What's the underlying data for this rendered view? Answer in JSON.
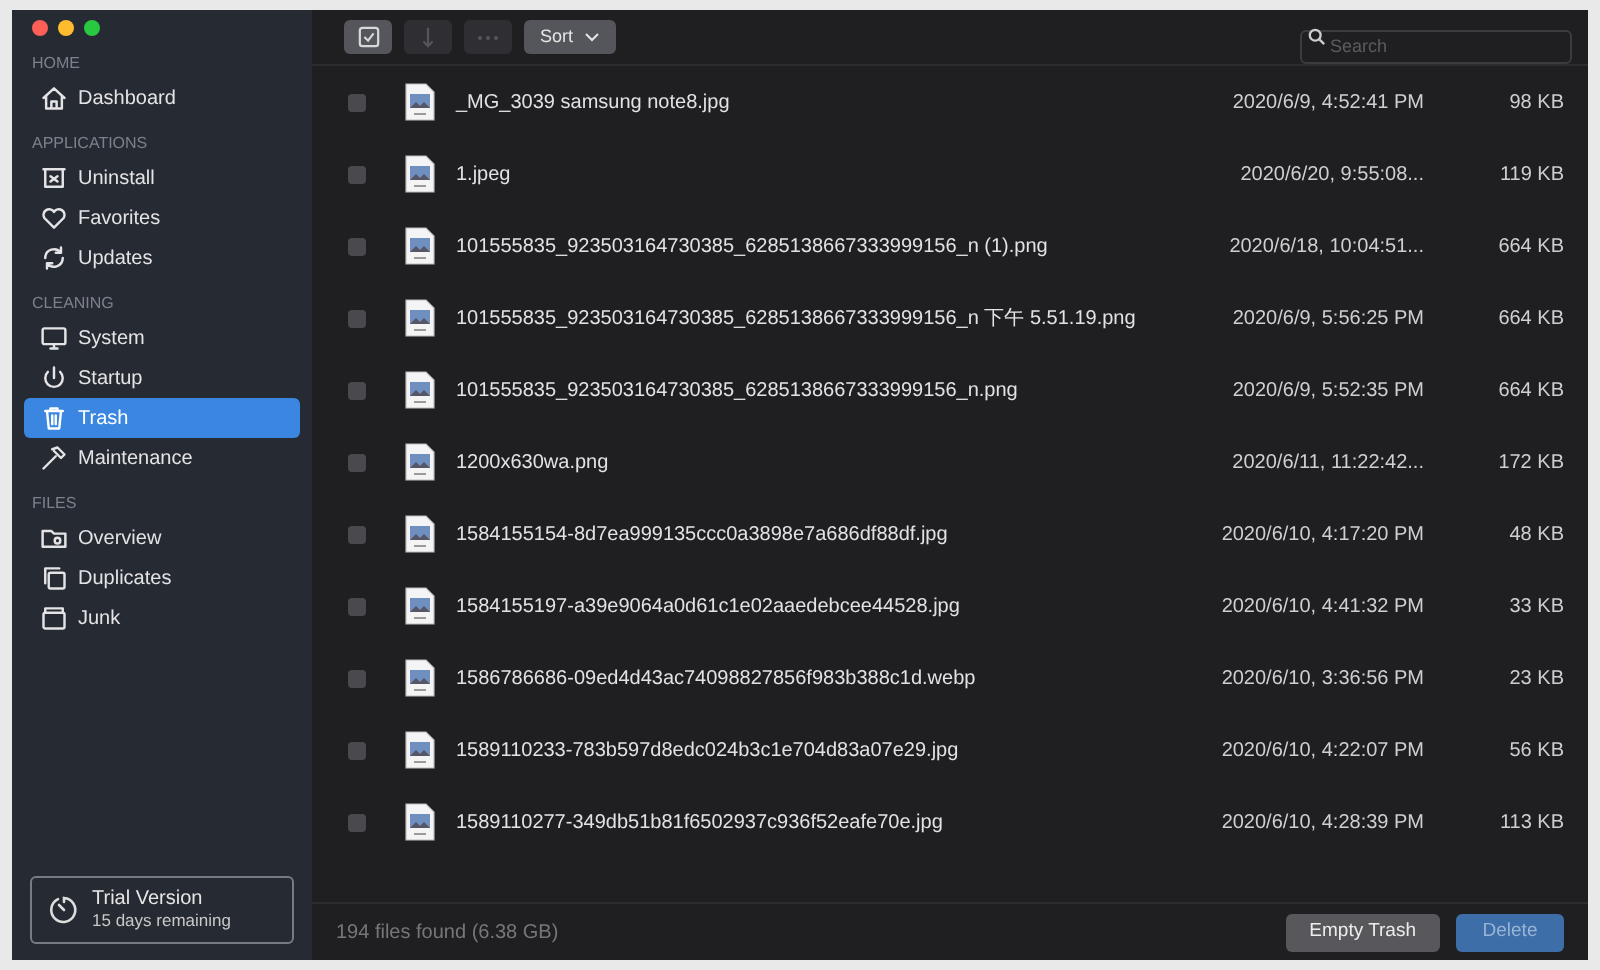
{
  "sidebar": {
    "sections": [
      {
        "heading": "HOME",
        "items": [
          {
            "label": "Dashboard",
            "kind": "home",
            "selected": false
          }
        ]
      },
      {
        "heading": "APPLICATIONS",
        "items": [
          {
            "label": "Uninstall",
            "kind": "uninstall",
            "selected": false
          },
          {
            "label": "Favorites",
            "kind": "heart",
            "selected": false
          },
          {
            "label": "Updates",
            "kind": "refresh",
            "selected": false
          }
        ]
      },
      {
        "heading": "CLEANING",
        "items": [
          {
            "label": "System",
            "kind": "monitor",
            "selected": false
          },
          {
            "label": "Startup",
            "kind": "power",
            "selected": false
          },
          {
            "label": "Trash",
            "kind": "trash",
            "selected": true
          },
          {
            "label": "Maintenance",
            "kind": "hammer",
            "selected": false
          }
        ]
      },
      {
        "heading": "FILES",
        "items": [
          {
            "label": "Overview",
            "kind": "folder",
            "selected": false
          },
          {
            "label": "Duplicates",
            "kind": "copy",
            "selected": false
          },
          {
            "label": "Junk",
            "kind": "box",
            "selected": false
          }
        ]
      }
    ],
    "trial": {
      "title": "Trial Version",
      "subtitle": "15 days remaining"
    }
  },
  "toolbar": {
    "buttons": [
      {
        "kind": "check",
        "disabled": false
      },
      {
        "kind": "arrow",
        "disabled": true
      },
      {
        "kind": "more",
        "disabled": true
      }
    ],
    "sort": {
      "label": "Sort"
    },
    "search": {
      "placeholder": "Search"
    }
  },
  "files": [
    {
      "name": "_MG_3039 samsung note8.jpg",
      "date": "2020/6/9, 4:52:41 PM",
      "size": "98 KB",
      "checked": false
    },
    {
      "name": "1.jpeg",
      "date": "2020/6/20, 9:55:08...",
      "size": "119 KB",
      "checked": false
    },
    {
      "name": "101555835_923503164730385_6285138667333999156_n (1).png",
      "date": "2020/6/18, 10:04:51...",
      "size": "664 KB",
      "checked": false
    },
    {
      "name": "101555835_923503164730385_6285138667333999156_n 下午 5.51.19.png",
      "date": "2020/6/9, 5:56:25 PM",
      "size": "664 KB",
      "checked": false
    },
    {
      "name": "101555835_923503164730385_6285138667333999156_n.png",
      "date": "2020/6/9, 5:52:35 PM",
      "size": "664 KB",
      "checked": false
    },
    {
      "name": "1200x630wa.png",
      "date": "2020/6/11, 11:22:42...",
      "size": "172 KB",
      "checked": false
    },
    {
      "name": "1584155154-8d7ea999135ccc0a3898e7a686df88df.jpg",
      "date": "2020/6/10, 4:17:20 PM",
      "size": "48 KB",
      "checked": false
    },
    {
      "name": "1584155197-a39e9064a0d61c1e02aaedebcee44528.jpg",
      "date": "2020/6/10, 4:41:32 PM",
      "size": "33 KB",
      "checked": false
    },
    {
      "name": "1586786686-09ed4d43ac74098827856f983b388c1d.webp",
      "date": "2020/6/10, 3:36:56 PM",
      "size": "23 KB",
      "checked": false
    },
    {
      "name": "1589110233-783b597d8edc024b3c1e704d83a07e29.jpg",
      "date": "2020/6/10, 4:22:07 PM",
      "size": "56 KB",
      "checked": false
    },
    {
      "name": "1589110277-349db51b81f6502937c936f52eafe70e.jpg",
      "date": "2020/6/10, 4:28:39 PM",
      "size": "113 KB",
      "checked": false
    }
  ],
  "footer": {
    "summary": "194 files found (6.38 GB)",
    "buttons": [
      {
        "label": "Empty Trash",
        "kind": "secondary"
      },
      {
        "label": "Delete",
        "kind": "primary"
      }
    ]
  }
}
